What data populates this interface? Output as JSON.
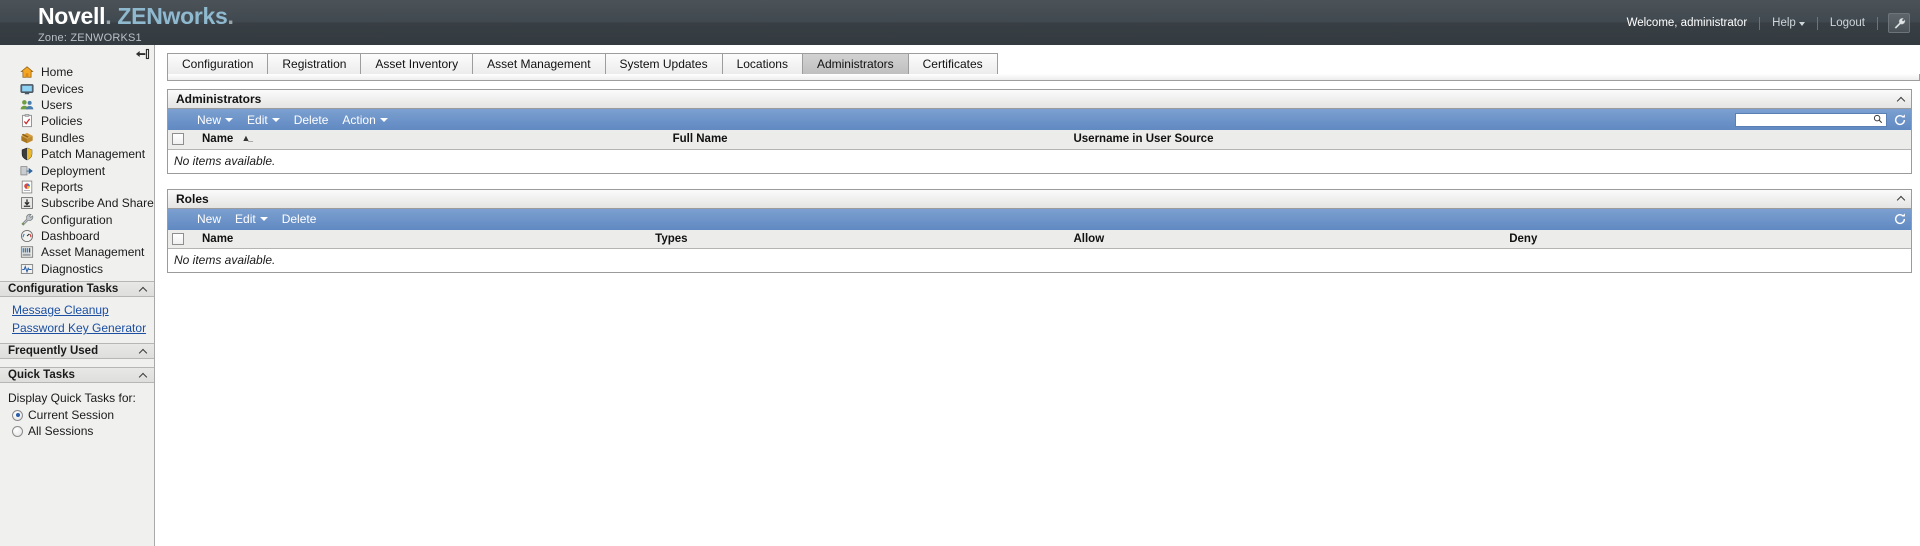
{
  "header": {
    "brand_novell": "Novell",
    "brand_dot": ".",
    "brand_zen": "ZENworks",
    "brand_zen_dot": ".",
    "zone": "Zone: ZENWORKS1",
    "welcome": "Welcome, administrator",
    "help": "Help",
    "logout": "Logout",
    "wrench_icon": "wrench-icon",
    "bg_color": "#3d4448",
    "accent_color": "#8fb9cf"
  },
  "sidebar": {
    "collapse_icon": "collapse-panel-icon",
    "items": [
      {
        "label": "Home",
        "icon": "home-icon"
      },
      {
        "label": "Devices",
        "icon": "monitor-icon"
      },
      {
        "label": "Users",
        "icon": "users-icon"
      },
      {
        "label": "Policies",
        "icon": "clipboard-check-icon"
      },
      {
        "label": "Bundles",
        "icon": "package-icon"
      },
      {
        "label": "Patch Management",
        "icon": "shield-icon"
      },
      {
        "label": "Deployment",
        "icon": "deploy-arrow-icon"
      },
      {
        "label": "Reports",
        "icon": "chart-report-icon"
      },
      {
        "label": "Subscribe And Share",
        "icon": "download-box-icon"
      },
      {
        "label": "Configuration",
        "icon": "wrench-icon"
      },
      {
        "label": "Dashboard",
        "icon": "gauge-icon"
      },
      {
        "label": "Asset Management",
        "icon": "barcode-icon"
      },
      {
        "label": "Diagnostics",
        "icon": "pulse-icon"
      }
    ],
    "sections": [
      {
        "title": "Configuration Tasks",
        "chevron": "chevron-up-icon"
      },
      {
        "title": "Frequently Used",
        "chevron": "chevron-up-icon"
      },
      {
        "title": "Quick Tasks",
        "chevron": "chevron-up-icon"
      }
    ],
    "config_tasks": [
      {
        "label": "Message Cleanup"
      },
      {
        "label": "Password Key Generator"
      }
    ],
    "quick_tasks": {
      "label": "Display Quick Tasks for:",
      "options": [
        {
          "label": "Current Session",
          "selected": true
        },
        {
          "label": "All Sessions",
          "selected": false
        }
      ]
    }
  },
  "tabs": [
    {
      "label": "Configuration",
      "active": false
    },
    {
      "label": "Registration",
      "active": false
    },
    {
      "label": "Asset Inventory",
      "active": false
    },
    {
      "label": "Asset Management",
      "active": false
    },
    {
      "label": "System Updates",
      "active": false
    },
    {
      "label": "Locations",
      "active": false
    },
    {
      "label": "Administrators",
      "active": true
    },
    {
      "label": "Certificates",
      "active": false
    }
  ],
  "administrators_panel": {
    "title": "Administrators",
    "collapse_icon": "chevron-up-icon",
    "toolbar": {
      "new": "New",
      "edit": "Edit",
      "delete": "Delete",
      "action": "Action",
      "search_placeholder": "",
      "search_value": "",
      "search_icon": "search-icon",
      "refresh_icon": "refresh-icon"
    },
    "columns": [
      "Name",
      "Full Name",
      "Username in User Source"
    ],
    "sort_column": "Name",
    "sort_icon": "sort-ascending-icon",
    "empty_message": "No items available.",
    "rows": []
  },
  "roles_panel": {
    "title": "Roles",
    "collapse_icon": "chevron-up-icon",
    "toolbar": {
      "new": "New",
      "edit": "Edit",
      "delete": "Delete",
      "refresh_icon": "refresh-icon"
    },
    "columns": [
      "Name",
      "Types",
      "Allow",
      "Deny"
    ],
    "empty_message": "No items available.",
    "rows": []
  }
}
